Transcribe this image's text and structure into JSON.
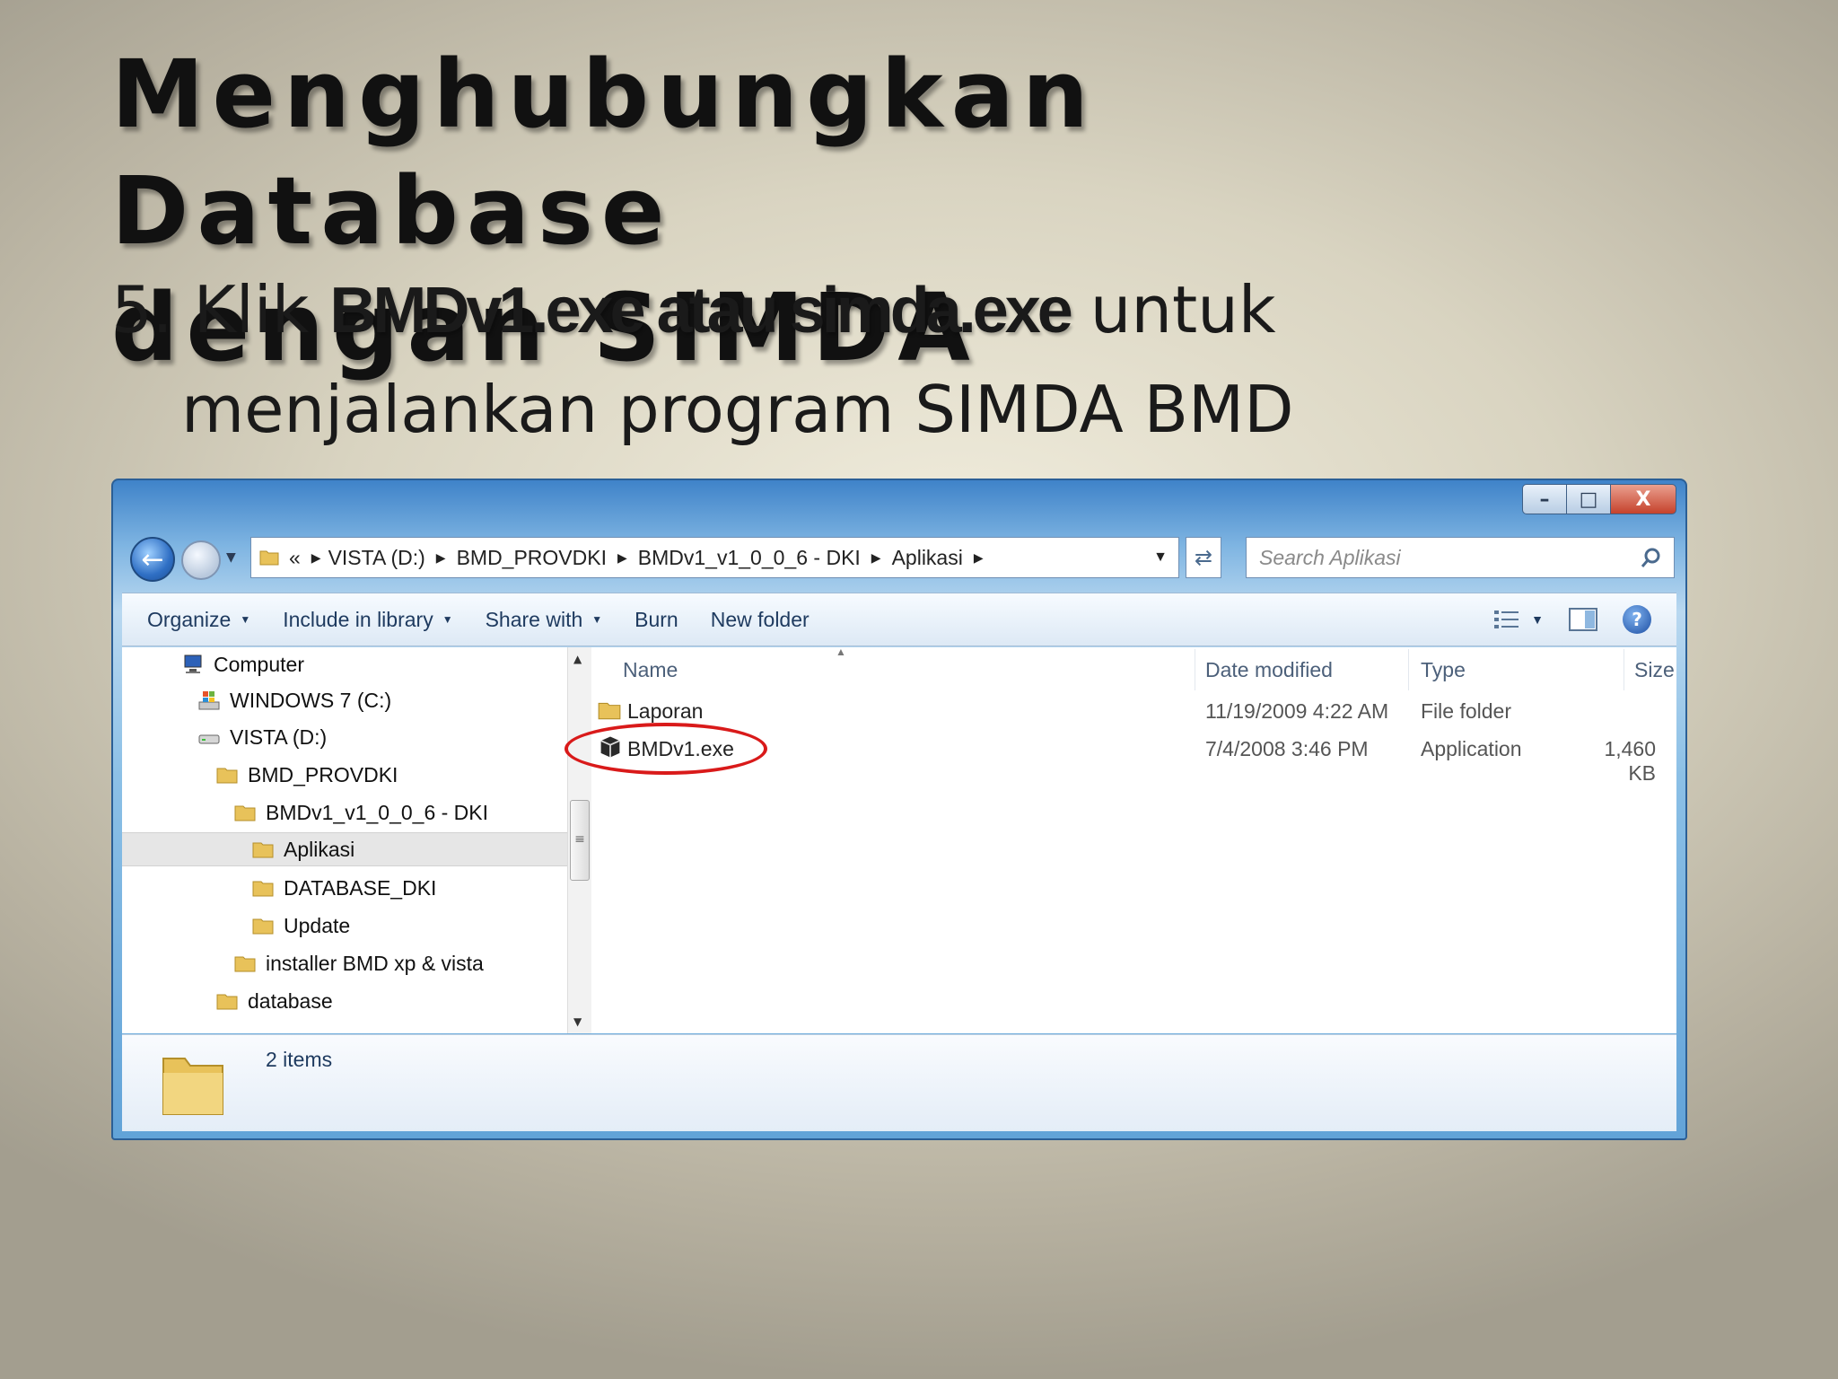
{
  "slide": {
    "title_line1": "Menghubungkan Database",
    "title_line2": "dengan SIMDA",
    "step_prefix": "5. Klik ",
    "step_bold": "BMDv1.exe  atau simda.exe",
    "step_suffix": " untuk",
    "step_line2": "menjalankan program SIMDA BMD"
  },
  "window": {
    "controls": {
      "minimize": "–",
      "maximize": "□",
      "close": "X"
    },
    "address": {
      "overflow": "«",
      "crumbs": [
        "VISTA (D:)",
        "BMD_PROVDKI",
        "BMDv1_v1_0_0_6 - DKI",
        "Aplikasi"
      ]
    },
    "search_placeholder": "Search Aplikasi",
    "toolbar": {
      "organize": "Organize",
      "include_in_library": "Include in library",
      "share_with": "Share with",
      "burn": "Burn",
      "new_folder": "New folder",
      "help": "?"
    },
    "tree": [
      {
        "label": "Computer",
        "icon": "computer-icon"
      },
      {
        "label": "WINDOWS 7 (C:)",
        "icon": "windows-drive-icon"
      },
      {
        "label": "VISTA (D:)",
        "icon": "drive-icon"
      },
      {
        "label": "BMD_PROVDKI",
        "icon": "folder-icon"
      },
      {
        "label": "BMDv1_v1_0_0_6 - DKI",
        "icon": "folder-icon"
      },
      {
        "label": "Aplikasi",
        "icon": "folder-icon",
        "selected": true
      },
      {
        "label": "DATABASE_DKI",
        "icon": "folder-icon"
      },
      {
        "label": "Update",
        "icon": "folder-icon"
      },
      {
        "label": "installer BMD xp & vista",
        "icon": "folder-icon"
      },
      {
        "label": "database",
        "icon": "folder-icon"
      }
    ],
    "columns": {
      "name": "Name",
      "date_modified": "Date modified",
      "type": "Type",
      "size": "Size"
    },
    "files": [
      {
        "name": "Laporan",
        "date": "11/19/2009 4:22 AM",
        "type": "File folder",
        "size": "",
        "icon": "folder-icon"
      },
      {
        "name": "BMDv1.exe",
        "date": "7/4/2008 3:46 PM",
        "type": "Application",
        "size": "1,460 KB",
        "icon": "application-icon",
        "highlighted": true
      }
    ],
    "status": {
      "item_count": "2 items"
    },
    "colors": {
      "highlight_ring": "#d91a1a",
      "folder": "#e8c25a",
      "frame": "#62a3d8"
    }
  }
}
